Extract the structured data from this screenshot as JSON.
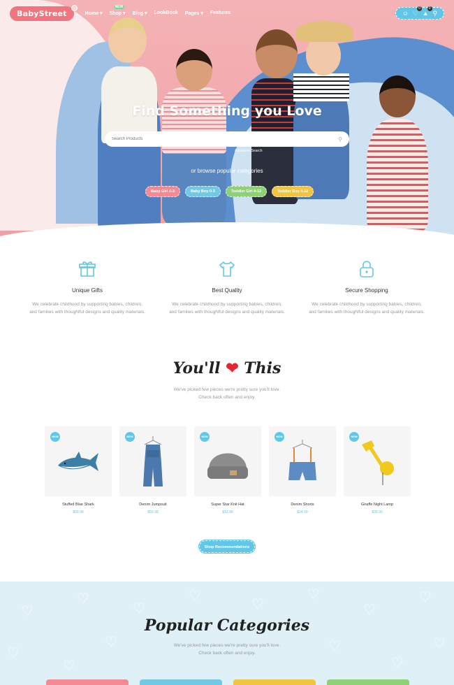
{
  "brand": "BabyStreet",
  "nav": {
    "items": [
      "Home",
      "Shop",
      "Blog",
      "LookBook",
      "Pages",
      "Features"
    ],
    "shop_badge": "NEW",
    "wishlist_count": "0",
    "cart_count": "0"
  },
  "hero": {
    "title": "Find Something you Love",
    "search_placeholder": "Search Products",
    "advanced_search": "Advanced Search",
    "browse_text": "or browse popular categories",
    "categories": [
      "Baby Girl 0-3",
      "Baby Boy 0-3",
      "Toddler Girl 4-12",
      "Toddler Boy 4-12"
    ]
  },
  "features": [
    {
      "title": "Unique Gifts",
      "text": "We celebrate childhood by supporting babies, children, and families with thoughtful designs and quality materials."
    },
    {
      "title": "Best Quality",
      "text": "We celebrate childhood by supporting babies, children, and families with thoughtful designs and quality materials."
    },
    {
      "title": "Secure Shopping",
      "text": "We celebrate childhood by supporting babies, children, and families with thoughtful designs and quality materials."
    }
  ],
  "love_section": {
    "title_start": "You'll",
    "title_end": "This",
    "subtitle_line1": "We've picked few pieces we're pretty sure you'll love.",
    "subtitle_line2": "Check back often and enjoy."
  },
  "products": [
    {
      "badge": "NEW",
      "name": "Stuffed Blue Shark",
      "price": "$59.99"
    },
    {
      "badge": "NEW",
      "name": "Denim Jumpsuit",
      "price": "$59.99"
    },
    {
      "badge": "NEW",
      "name": "Super Star Knit Hat",
      "price": "$12.99"
    },
    {
      "badge": "NEW",
      "name": "Denim Shorts",
      "price": "$24.99"
    },
    {
      "badge": "NEW",
      "name": "Giraffe Night Lamp",
      "price": "$39.90"
    }
  ],
  "shop_button": "Shop Recommendations",
  "popular": {
    "title": "Popular Categories",
    "subtitle_line1": "We've picked few pieces we're pretty sure you'll love.",
    "subtitle_line2": "Check back often and enjoy."
  },
  "colors": {
    "accent_blue": "#62c7e6",
    "logo_pink": "#f0757f",
    "hero_pink": "#f2a8ac",
    "heart_red": "#e6262e"
  }
}
